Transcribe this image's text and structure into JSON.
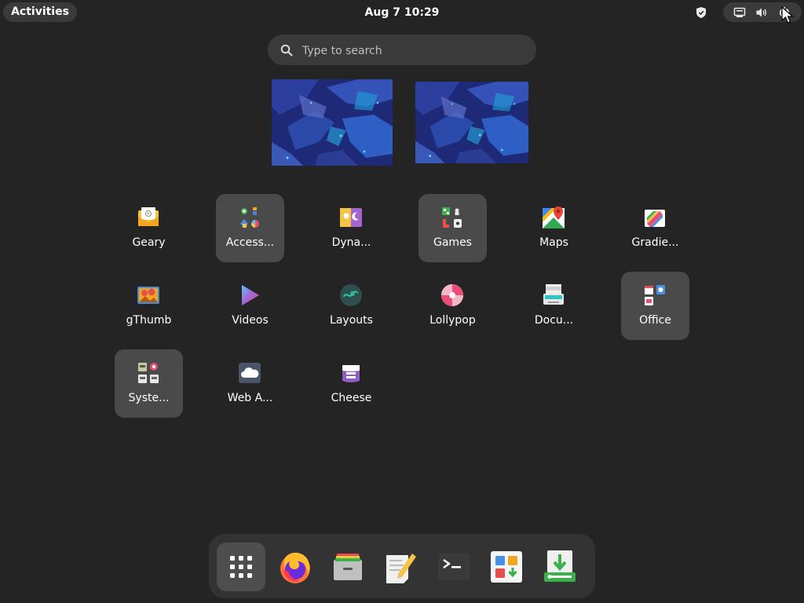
{
  "topbar": {
    "activities_label": "Activities",
    "clock": "Aug 7  10:29",
    "tray_icons": [
      "shield-icon",
      "network-icon",
      "volume-icon",
      "power-icon"
    ]
  },
  "search": {
    "placeholder": "Type to search",
    "value": ""
  },
  "apps": [
    {
      "label": "Geary",
      "icon": "geary-icon",
      "folder": false
    },
    {
      "label": "Access...",
      "icon": "accessories-folder-icon",
      "folder": true
    },
    {
      "label": "Dyna...",
      "icon": "dynamic-wallpaper-icon",
      "folder": false
    },
    {
      "label": "Games",
      "icon": "games-folder-icon",
      "folder": true
    },
    {
      "label": "Maps",
      "icon": "maps-icon",
      "folder": false
    },
    {
      "label": "Gradie...",
      "icon": "gradience-icon",
      "folder": false
    },
    {
      "label": "gThumb",
      "icon": "gthumb-icon",
      "folder": false
    },
    {
      "label": "Videos",
      "icon": "videos-icon",
      "folder": false
    },
    {
      "label": "Layouts",
      "icon": "layouts-icon",
      "folder": false
    },
    {
      "label": "Lollypop",
      "icon": "lollypop-icon",
      "folder": false
    },
    {
      "label": "Docu...",
      "icon": "document-scanner-icon",
      "folder": false
    },
    {
      "label": "Office",
      "icon": "office-folder-icon",
      "folder": true
    },
    {
      "label": "Syste...",
      "icon": "system-folder-icon",
      "folder": true
    },
    {
      "label": "Web A...",
      "icon": "web-apps-icon",
      "folder": false
    },
    {
      "label": "Cheese",
      "icon": "cheese-icon",
      "folder": false
    }
  ],
  "dash": [
    {
      "name": "show-apps",
      "icon": "app-grid-icon",
      "active": true
    },
    {
      "name": "firefox",
      "icon": "firefox-icon",
      "active": false
    },
    {
      "name": "files",
      "icon": "files-icon",
      "active": false
    },
    {
      "name": "text-editor",
      "icon": "text-editor-icon",
      "active": false
    },
    {
      "name": "terminal",
      "icon": "terminal-icon",
      "active": false
    },
    {
      "name": "software",
      "icon": "software-icon",
      "active": false
    },
    {
      "name": "installer",
      "icon": "installer-icon",
      "active": false
    }
  ],
  "colors": {
    "background": "#242424",
    "pill": "#3a3a3a",
    "folder_tile": "#4a4a4a",
    "dash": "#333333"
  }
}
